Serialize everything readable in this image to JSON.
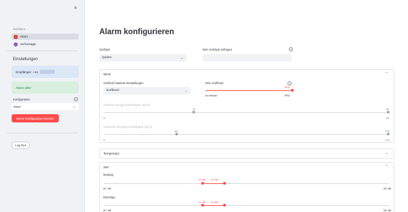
{
  "sidebar": {
    "close_icon": "×",
    "nav_label": "Surfalarm",
    "nav_items": [
      {
        "label": "Alarm",
        "icon": "alarm-clock-icon"
      },
      {
        "label": "Vorhersage",
        "icon": "crystal-ball-icon"
      }
    ],
    "settings_heading": "Einstellungen",
    "recipient_label": "Empfänger: +41",
    "alarm_status": "Alarm aktiv",
    "config_label": "Konfiguration",
    "config_value": "PRO",
    "delete_button": "Diese Konfiguration löschen",
    "logout_button": "Log Out"
  },
  "main": {
    "title": "Alarm konfigurieren",
    "surfspot_label": "Surfspot",
    "surfspot_value": "Quiten",
    "own_spot_label": "Dein Surfspot anfragen",
    "wind": {
      "header": "Wind",
      "preset_label": "Surflevel basierte Einstellungen",
      "preset_value": "Surflevel",
      "level_label": "Dein Surflevel",
      "level_value": "PRO",
      "level_min": "Anfänger",
      "level_max": "PRO",
      "level_fraction": 1.0,
      "minspeed_label": "erlaubte Windgeschwindigkeit (km/h)",
      "minspeed_value": "23",
      "minspeed_min": "0",
      "minspeed_max": "60",
      "minspeed_top_max": "60",
      "maxspeed_label": "maximale Windgeschwindigkeit (km/h)",
      "maxspeed_value": "40",
      "maxspeed_min": "0",
      "maxspeed_max": "120",
      "maxspeed_top_max": "120"
    },
    "temperature": {
      "header": "Temperatur"
    },
    "time": {
      "header": "Zeit",
      "days": [
        {
          "label": "Montag:",
          "range": "11:00 - 12:00",
          "min": "07:00",
          "max": "20:00"
        },
        {
          "label": "Dienstag:",
          "range": "11:00 - 12:00",
          "min": "07:00",
          "max": "20:00"
        }
      ]
    }
  },
  "colors": {
    "accent": "#ff4b4b",
    "sidebar_bg": "#f0f2f6",
    "info_bg": "#dce7f7",
    "success_bg": "#d9efe0"
  }
}
